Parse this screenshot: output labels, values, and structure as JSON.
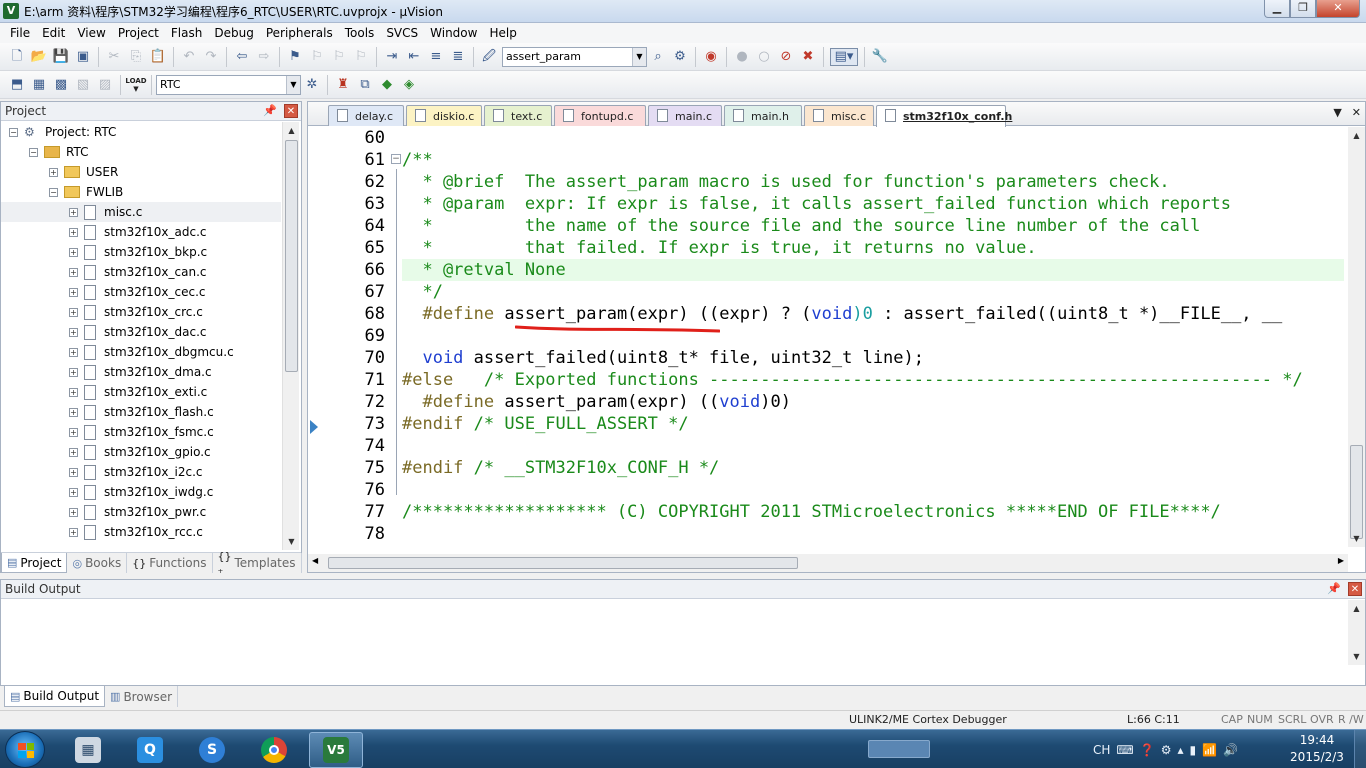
{
  "window": {
    "title": "E:\\arm 资料\\程序\\STM32学习编程\\程序6_RTC\\USER\\RTC.uvprojx - µVision",
    "app_icon": "V",
    "controls": [
      "minimize-icon",
      "restore-icon",
      "close-icon"
    ]
  },
  "menu": [
    "File",
    "Edit",
    "View",
    "Project",
    "Flash",
    "Debug",
    "Peripherals",
    "Tools",
    "SVCS",
    "Window",
    "Help"
  ],
  "toolbar1": {
    "find_combo": "assert_param"
  },
  "toolbar2": {
    "target_combo": "RTC",
    "load_label": "LOAD"
  },
  "project_panel": {
    "title": "Project",
    "tree": {
      "project": "Project: RTC",
      "target": "RTC",
      "groups": [
        {
          "name": "USER",
          "expanded": false
        },
        {
          "name": "FWLIB",
          "expanded": true
        }
      ],
      "files": [
        "misc.c",
        "stm32f10x_adc.c",
        "stm32f10x_bkp.c",
        "stm32f10x_can.c",
        "stm32f10x_cec.c",
        "stm32f10x_crc.c",
        "stm32f10x_dac.c",
        "stm32f10x_dbgmcu.c",
        "stm32f10x_dma.c",
        "stm32f10x_exti.c",
        "stm32f10x_flash.c",
        "stm32f10x_fsmc.c",
        "stm32f10x_gpio.c",
        "stm32f10x_i2c.c",
        "stm32f10x_iwdg.c",
        "stm32f10x_pwr.c",
        "stm32f10x_rcc.c"
      ],
      "selected": "misc.c"
    },
    "tabs": [
      {
        "label": "Project",
        "active": true
      },
      {
        "label": "Books",
        "active": false
      },
      {
        "label": "Functions",
        "active": false
      },
      {
        "label": "Templates",
        "active": false
      }
    ]
  },
  "editor": {
    "tabs": [
      {
        "label": "delay.c",
        "color": "#dfe8f6"
      },
      {
        "label": "diskio.c",
        "color": "#fcf3c4"
      },
      {
        "label": "text.c",
        "color": "#e6f1cf"
      },
      {
        "label": "fontupd.c",
        "color": "#fadada"
      },
      {
        "label": "main.c",
        "color": "#e4dcf3"
      },
      {
        "label": "main.h",
        "color": "#dff0ea"
      },
      {
        "label": "misc.c",
        "color": "#fbe6cf"
      },
      {
        "label": "stm32f10x_conf.h",
        "color": "#ffffff",
        "active": true
      }
    ],
    "line_numbers": [
      "60",
      "61",
      "62",
      "63",
      "64",
      "65",
      "66",
      "67",
      "68",
      "69",
      "70",
      "71",
      "72",
      "73",
      "74",
      "75",
      "76",
      "77",
      "78"
    ],
    "current_line": "66",
    "code": {
      "l60": "",
      "l61": "/**",
      "l62": "  * @brief  The assert_param macro is used for function's parameters check.",
      "l63": "  * @param  expr: If expr is false, it calls assert_failed function which reports",
      "l64": "  *         the name of the source file and the source line number of the call",
      "l65": "  *         that failed. If expr is true, it returns no value.",
      "l66": "  * @retval None",
      "l67": "  */",
      "l68_pp": "  #define ",
      "l68_a": "assert_param(expr) ((expr) ? (",
      "l68_kw": "void",
      "l68_n": ")0",
      "l68_b": " : assert_failed((uint8_t *)__FILE__, __",
      "l69": "/* Exported functions ------------------------------------------------------- */",
      "l70_kw": "  void",
      "l70_rest": " assert_failed(uint8_t* file, uint32_t line);",
      "l71": "#else",
      "l72_pp": "  #define",
      "l72_a": " assert_param(expr) ((",
      "l72_kw": "void",
      "l72_b": ")0)",
      "l73_pp": "#endif",
      "l73_cm": " /* USE_FULL_ASSERT */",
      "l74": "",
      "l75_pp": "#endif",
      "l75_cm": " /* __STM32F10x_CONF_H */",
      "l76": "",
      "l77": "/******************* (C) COPYRIGHT 2011 STMicroelectronics *****END OF FILE****/",
      "l78": ""
    }
  },
  "build_output": {
    "title": "Build Output",
    "tabs": [
      "Build Output",
      "Browser"
    ]
  },
  "status": {
    "debugger": "ULINK2/ME Cortex Debugger",
    "position": "L:66 C:11",
    "indicators": [
      "CAP",
      "NUM",
      "SCRL",
      "OVR",
      "R /W"
    ]
  },
  "taskbar": {
    "apps": [
      "calculator-icon",
      "qq-icon",
      "sogou-icon",
      "chrome-icon",
      "keil-uvision-icon"
    ],
    "tray_lang": "CH",
    "time": "19:44",
    "date": "2015/2/3",
    "keil_label": "V5"
  }
}
